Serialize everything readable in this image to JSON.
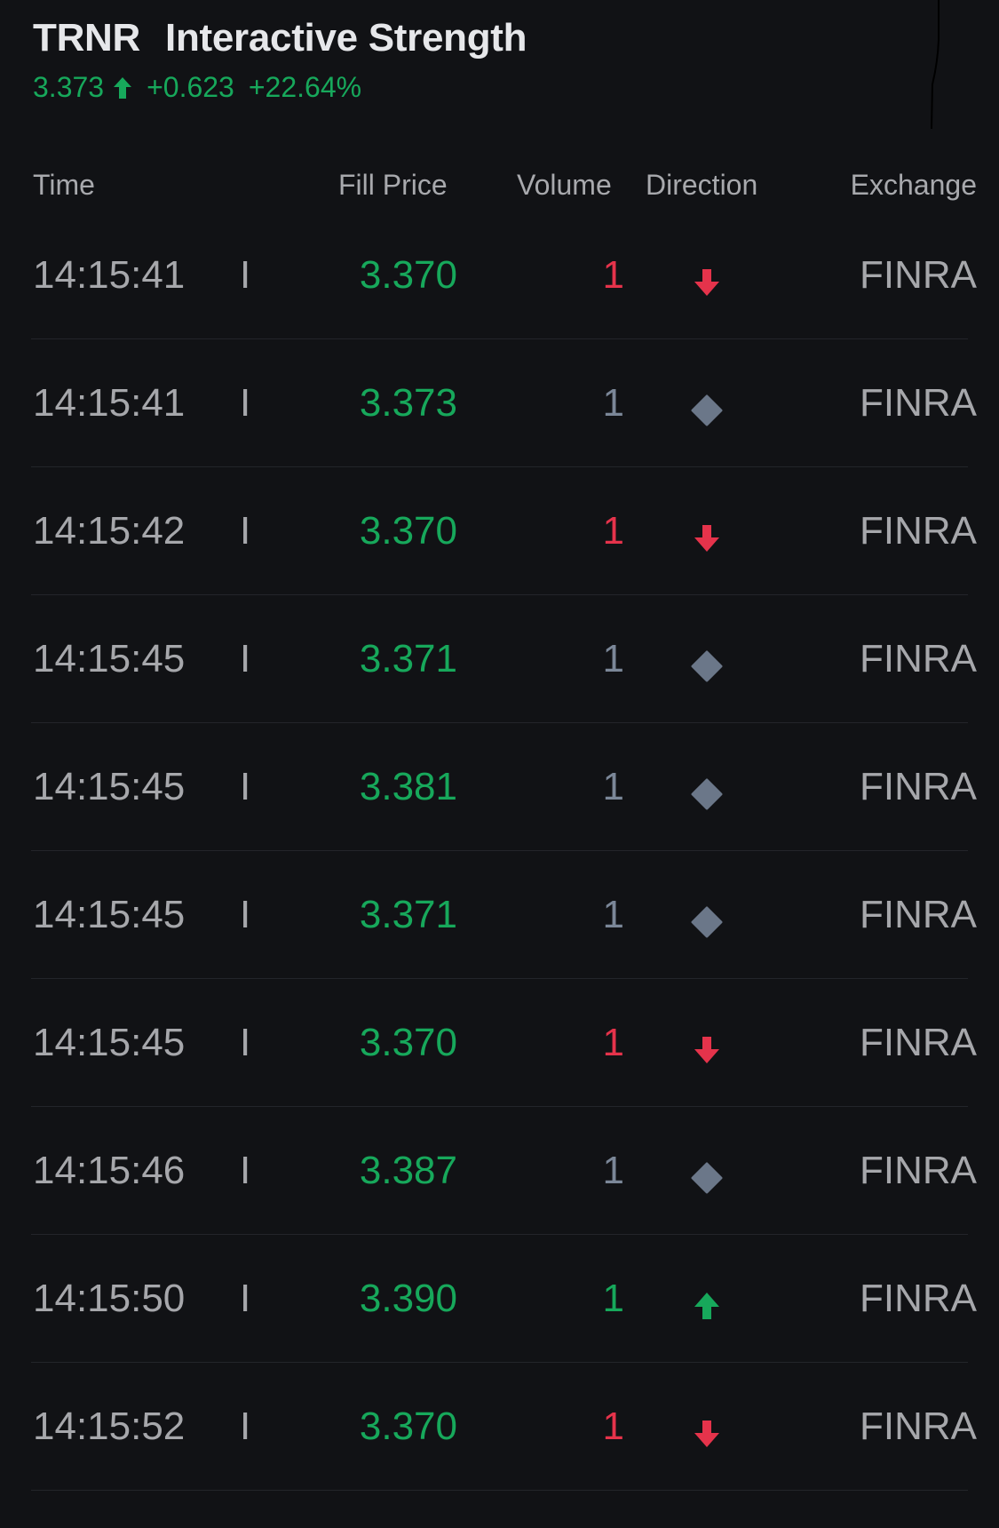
{
  "header": {
    "ticker": "TRNR",
    "company_name": "Interactive Strength",
    "last_price": "3.373",
    "direction_icon": "arrow-up-icon",
    "change": "+0.623",
    "change_percent": "+22.64%"
  },
  "colors": {
    "background": "#111215",
    "up": "#17a85b",
    "down": "#e5334b",
    "neutral": "#6b7789",
    "muted_text": "#a6a7ab"
  },
  "columns": [
    "Time",
    "Fill Price",
    "Volume",
    "Direction",
    "Exchange"
  ],
  "trades": [
    {
      "time": "14:15:41",
      "condition": "I",
      "fill_price": "3.370",
      "volume": "1",
      "direction": "down",
      "exchange": "FINRA"
    },
    {
      "time": "14:15:41",
      "condition": "I",
      "fill_price": "3.373",
      "volume": "1",
      "direction": "neutral",
      "exchange": "FINRA"
    },
    {
      "time": "14:15:42",
      "condition": "I",
      "fill_price": "3.370",
      "volume": "1",
      "direction": "down",
      "exchange": "FINRA"
    },
    {
      "time": "14:15:45",
      "condition": "I",
      "fill_price": "3.371",
      "volume": "1",
      "direction": "neutral",
      "exchange": "FINRA"
    },
    {
      "time": "14:15:45",
      "condition": "I",
      "fill_price": "3.381",
      "volume": "1",
      "direction": "neutral",
      "exchange": "FINRA"
    },
    {
      "time": "14:15:45",
      "condition": "I",
      "fill_price": "3.371",
      "volume": "1",
      "direction": "neutral",
      "exchange": "FINRA"
    },
    {
      "time": "14:15:45",
      "condition": "I",
      "fill_price": "3.370",
      "volume": "1",
      "direction": "down",
      "exchange": "FINRA"
    },
    {
      "time": "14:15:46",
      "condition": "I",
      "fill_price": "3.387",
      "volume": "1",
      "direction": "neutral",
      "exchange": "FINRA"
    },
    {
      "time": "14:15:50",
      "condition": "I",
      "fill_price": "3.390",
      "volume": "1",
      "direction": "up",
      "exchange": "FINRA"
    },
    {
      "time": "14:15:52",
      "condition": "I",
      "fill_price": "3.370",
      "volume": "1",
      "direction": "down",
      "exchange": "FINRA"
    }
  ]
}
